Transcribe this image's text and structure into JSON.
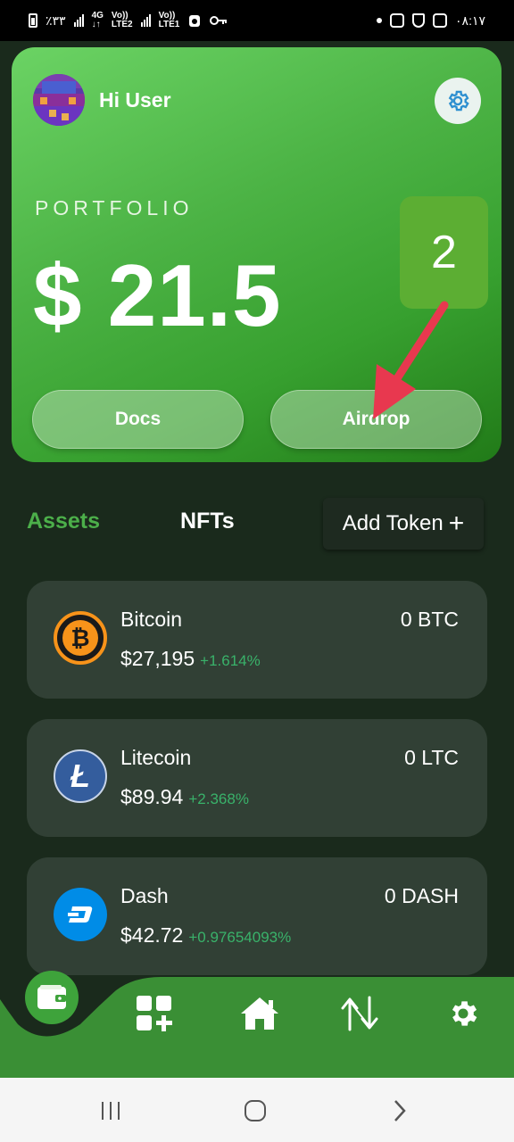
{
  "status_bar": {
    "left_text": "٪۳۳",
    "network_1": "4G",
    "network_1_sub": "LTE2",
    "network_2": "Vo))",
    "network_2_sub": "LTE1",
    "time": "۰۸:۱۷"
  },
  "header": {
    "greeting": "Hi User",
    "portfolio_label": "PORTFOLIO",
    "portfolio_value": "$ 21.5",
    "badge_count": "2",
    "docs_label": "Docs",
    "airdrop_label": "Airdrop"
  },
  "tabs": {
    "assets": "Assets",
    "nfts": "NFTs",
    "add_token": "Add Token",
    "add_token_icon": "+"
  },
  "assets": [
    {
      "name": "Bitcoin",
      "price": "$27,195",
      "change": "+1.614%",
      "balance": "0 BTC",
      "icon": "bitcoin-icon",
      "color": "#f7931a"
    },
    {
      "name": "Litecoin",
      "price": "$89.94",
      "change": "+2.368%",
      "balance": "0 LTC",
      "icon": "litecoin-icon",
      "color": "#345d9d"
    },
    {
      "name": "Dash",
      "price": "$42.72",
      "change": "+0.97654093%",
      "balance": "0 DASH",
      "icon": "dash-icon",
      "color": "#008ce7"
    }
  ],
  "colors": {
    "accent_green": "#4caf4a",
    "card_bg": "#314035",
    "positive_change": "#39b26a",
    "annotation_arrow": "#e8384f"
  },
  "bottom_nav": [
    "wallet-icon",
    "add-widget-icon",
    "home-icon",
    "swap-icon",
    "settings-icon"
  ]
}
